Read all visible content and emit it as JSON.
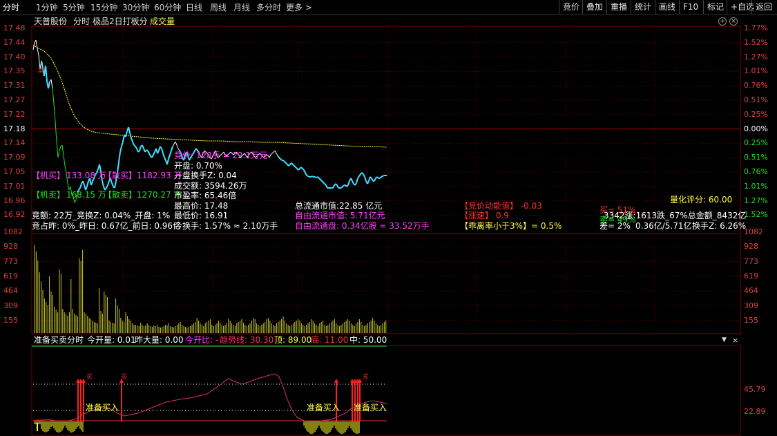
{
  "tabs": [
    "分时",
    "1分钟",
    "5分钟",
    "15分钟",
    "30分钟",
    "60分钟",
    "日线",
    "周线",
    "月线",
    "多分时",
    "更多 >"
  ],
  "right_buttons": [
    "竞价",
    "叠加",
    "重播",
    "统计",
    "画线",
    "F10",
    "标记",
    "+自选",
    "返回"
  ],
  "header": {
    "stock": "天普股份",
    "mode": "分时",
    "strategy": "极品2日打板分",
    "volume_label": "成交量"
  },
  "price_axis": [
    "17.48",
    "17.44",
    "17.40",
    "17.35",
    "17.31",
    "17.27",
    "17.22",
    "17.18",
    "17.14",
    "17.09",
    "17.05",
    "17.01",
    "16.96",
    "16.92"
  ],
  "pct_axis": [
    "1.77%",
    "1.52%",
    "1.27%",
    "1.01%",
    "0.76%",
    "0.51%",
    "0.25%",
    "0.00%",
    "0.25%",
    "0.51%",
    "0.76%",
    "1.01%",
    "1.27%",
    "1.52%"
  ],
  "vol_axis": [
    "1082",
    "928",
    "773",
    "619",
    "464",
    "309",
    "155"
  ],
  "ind_axis": [
    "45.79",
    "22.89"
  ],
  "flags": {
    "buy_char": "买",
    "sell_char": "卖"
  },
  "overlay": {
    "jijia": "竞价: 128手 = 22.1万元",
    "kaipan": "开盘: 0.70%",
    "kaipan_hsz": "开盘换手Z: 0.04",
    "chengjiao": "成交额: 3594.26万",
    "shiying": "市盈率: 65.46倍",
    "zuigao": "最高价: 17.48",
    "zuidi": "最低价: 16.91",
    "jinhuanshou": "今换手: 1.57% ≈ 2.10万手",
    "jimai1_label": "【机买】",
    "jimai1_val": "133.08 万",
    "sanmai1_label": "【散买】",
    "sanmai1_val": "1182.93 万",
    "jimai2_label": "【机卖】",
    "jimai2_val": "168.15 万",
    "sanmai2_label": "【散卖】",
    "sanmai2_val": "1270.27 万",
    "jinge": "竞额: 22万_竞换Z: 0.04%_开盘: 1%",
    "jinzhanzuo": "竞占昨: 0%_昨日: 0.67亿_前日: 0.96亿",
    "zongliutong": "总流通市值:22.85 亿元",
    "ziyou1": "自由流通市值: 5.71亿元",
    "ziyou2": "自由流通盘: 0.34亿股 ≈ 33.52万手",
    "jijiadong": "【竞价动能值】 -0.03",
    "zhangsu": "【涨速】 0.9",
    "guaili": "【乖离率小于3%】= 0.5%",
    "lianghua": "量化评分: 60.00",
    "mai51": "买= 51%",
    "mai49": "卖= 49%",
    "zhangdie": "3342涨:1613跌_67%总金额_8432亿",
    "cha": "差= 2%",
    "liutong": "0.36亿/5.71亿",
    "huanshou": "换手Z: 6.26%"
  },
  "indicator": {
    "name": "准备买卖分时",
    "jinkailiang": "今开量: 0.01",
    "zuodaliang": "昨大量: 0.00",
    "jinkaibi": "今开比: -",
    "qushixian": "趋势线: 30.30",
    "ding": "顶: 89.00",
    "di": "底: 11.00",
    "zhong": "中: 50.00",
    "signal": "准备买入"
  },
  "colors": {
    "grid": "#7a0000",
    "price": "#ffffff",
    "avg": "#ffff40",
    "down": "#40e0ff",
    "up_green": "#20e020",
    "red": "#ff3030",
    "magenta": "#ff40ff"
  }
}
